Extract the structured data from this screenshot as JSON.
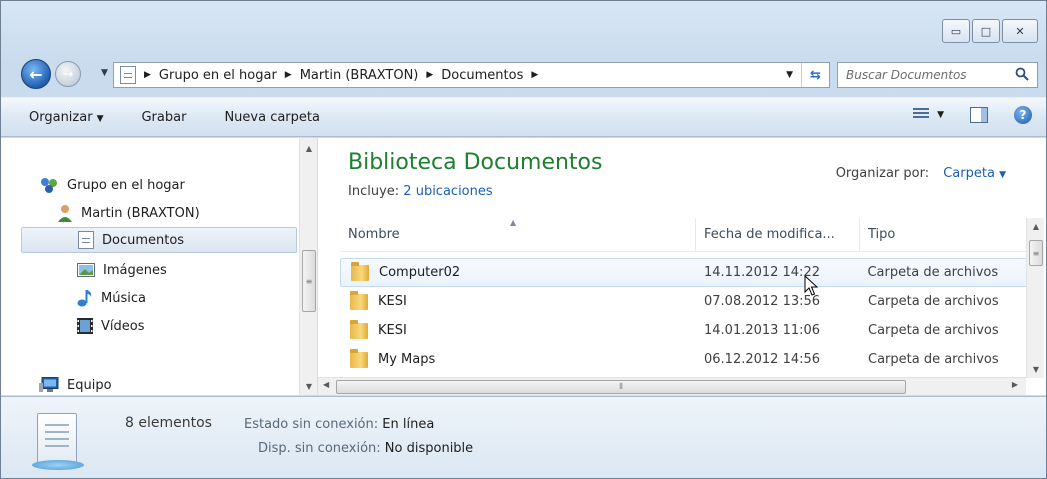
{
  "window": {
    "controls": {
      "minimize_icon": "minimize-icon",
      "maximize_icon": "maximize-icon",
      "close_icon": "close-icon"
    }
  },
  "address": {
    "breadcrumbs": [
      "Grupo en el hogar",
      "Martin (BRAXTON)",
      "Documentos"
    ],
    "search_placeholder": "Buscar Documentos"
  },
  "toolbar": {
    "organize": "Organizar",
    "burn": "Grabar",
    "new_folder": "Nueva carpeta"
  },
  "sidebar": {
    "items": [
      {
        "label": "Grupo en el hogar",
        "icon": "homegroup-icon"
      },
      {
        "label": "Martin (BRAXTON)",
        "icon": "user-icon"
      },
      {
        "label": "Documentos",
        "icon": "documents-icon",
        "selected": true
      },
      {
        "label": "Imágenes",
        "icon": "pictures-icon"
      },
      {
        "label": "Música",
        "icon": "music-icon"
      },
      {
        "label": "Vídeos",
        "icon": "videos-icon"
      },
      {
        "label": "Equipo",
        "icon": "computer-icon"
      }
    ]
  },
  "library": {
    "title": "Biblioteca Documentos",
    "includes_label": "Incluye:",
    "includes_link": "2 ubicaciones",
    "arrange_label": "Organizar por:",
    "arrange_value": "Carpeta"
  },
  "columns": {
    "name": "Nombre",
    "date": "Fecha de modifica...",
    "type": "Tipo"
  },
  "files": [
    {
      "name": "Computer02",
      "date": "14.11.2012 14:22",
      "type": "Carpeta de archivos"
    },
    {
      "name": "KESI",
      "date": "07.08.2012 13:56",
      "type": "Carpeta de archivos"
    },
    {
      "name": "KESI",
      "date": "14.01.2013 11:06",
      "type": "Carpeta de archivos"
    },
    {
      "name": "My Maps",
      "date": "06.12.2012 14:56",
      "type": "Carpeta de archivos"
    }
  ],
  "details": {
    "count": "8 elementos",
    "offline_state_label": "Estado sin conexión:",
    "offline_state_value": "En línea",
    "offline_avail_label": "Disp. sin conexión:",
    "offline_avail_value": "No disponible"
  },
  "colors": {
    "library_title": "#1e7f2e",
    "link": "#1a5fb4"
  }
}
